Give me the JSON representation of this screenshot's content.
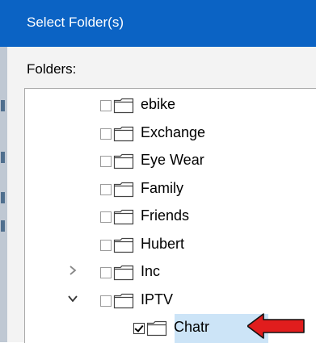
{
  "dialog": {
    "title": "Select Folder(s)"
  },
  "folders_label": "Folders:",
  "colors": {
    "titlebar": "#0b63c4",
    "selection": "#cce4f7",
    "arrow": "#e11d1d"
  },
  "tree": {
    "items": [
      {
        "label": "ebike",
        "level": 1,
        "expander": "none",
        "checked": false,
        "selected": false
      },
      {
        "label": "Exchange",
        "level": 1,
        "expander": "none",
        "checked": false,
        "selected": false
      },
      {
        "label": "Eye Wear",
        "level": 1,
        "expander": "none",
        "checked": false,
        "selected": false
      },
      {
        "label": "Family",
        "level": 1,
        "expander": "none",
        "checked": false,
        "selected": false
      },
      {
        "label": "Friends",
        "level": 1,
        "expander": "none",
        "checked": false,
        "selected": false
      },
      {
        "label": "Hubert",
        "level": 1,
        "expander": "none",
        "checked": false,
        "selected": false
      },
      {
        "label": "Inc",
        "level": 1,
        "expander": "collapsed",
        "checked": false,
        "selected": false
      },
      {
        "label": "IPTV",
        "level": 1,
        "expander": "expanded",
        "checked": false,
        "selected": false
      },
      {
        "label": "Chatr",
        "level": 2,
        "expander": "none",
        "checked": true,
        "selected": true
      }
    ]
  },
  "icons": {
    "expand_collapsed": "chevron-right-icon",
    "expand_expanded": "chevron-down-icon",
    "folder": "folder-icon",
    "pointer": "red-arrow-icon"
  }
}
